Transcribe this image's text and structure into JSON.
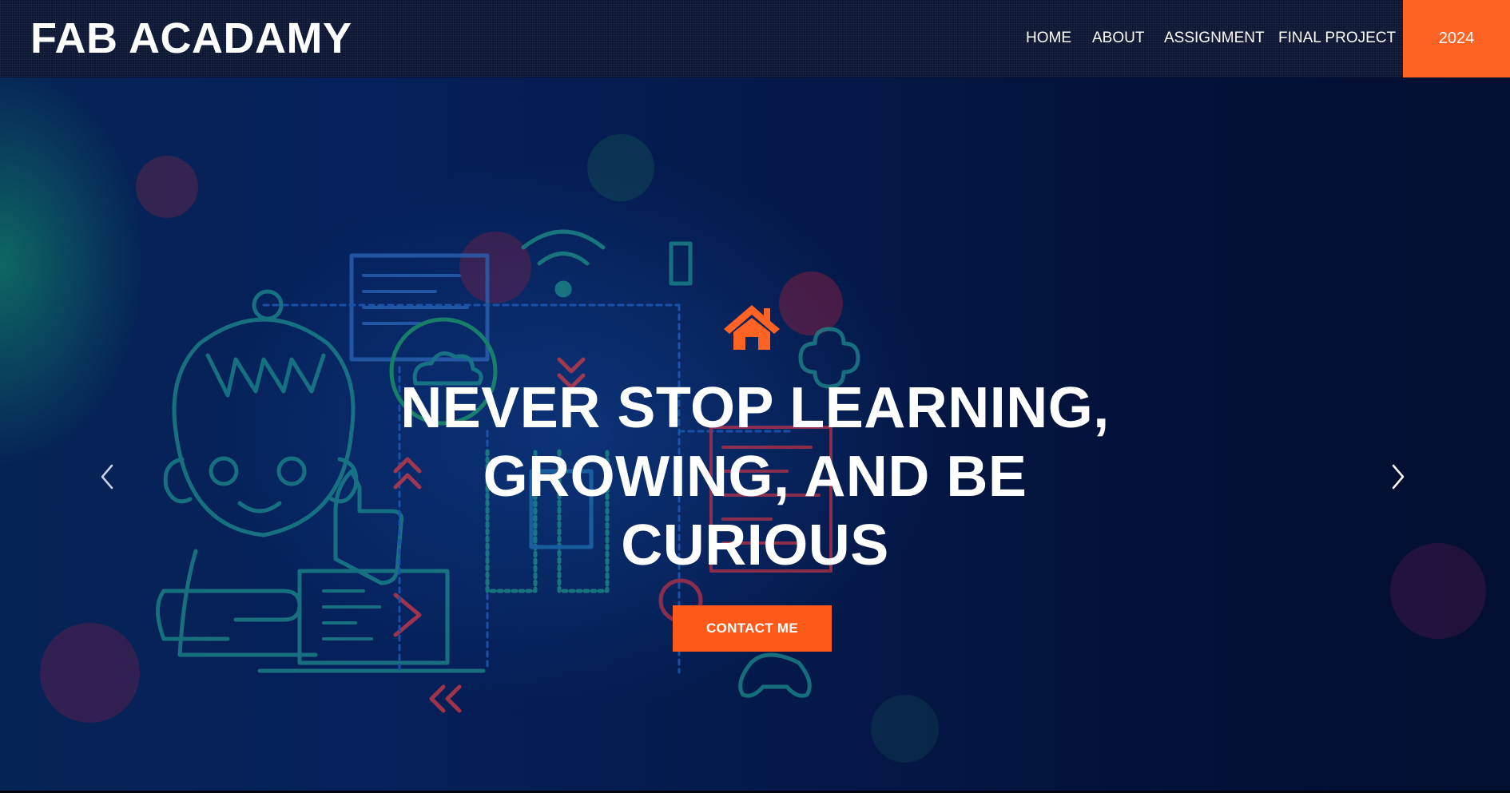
{
  "header": {
    "brand": "FAB ACADAMY",
    "nav": [
      {
        "label": "HOME"
      },
      {
        "label": "ABOUT"
      },
      {
        "label": "ASSIGNMENT"
      },
      {
        "label": "FINAL PROJECT"
      }
    ],
    "year_button": "2024"
  },
  "hero": {
    "icon": "home-icon",
    "headline_lines": [
      "NEVER STOP LEARNING,",
      "GROWING, AND BE",
      "CURIOUS"
    ],
    "cta_label": "CONTACT ME",
    "prev_icon": "chevron-left-icon",
    "next_icon": "chevron-right-icon"
  },
  "colors": {
    "accent": "#ff6323",
    "background": "#041848",
    "header_bg": "#0c1633",
    "text": "#ffffff"
  }
}
